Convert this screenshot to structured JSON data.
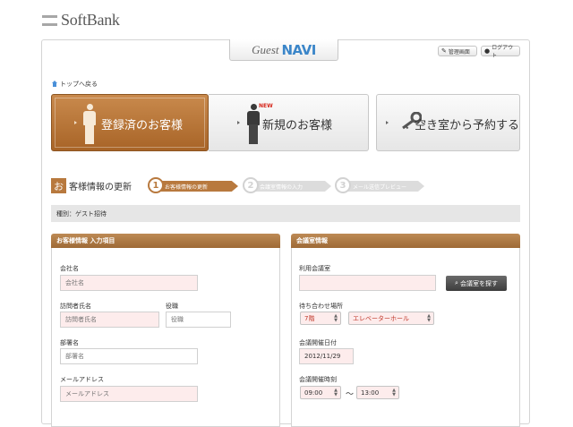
{
  "brand": {
    "name": "SoftBank"
  },
  "app_logo": {
    "guest": "Guest",
    "navi": "NAVI"
  },
  "header_buttons": {
    "admin": "管理画面",
    "logout": "ログアウト"
  },
  "back_link": "トップへ戻る",
  "nav": {
    "registered": "登録済のお客様",
    "new": "新規のお客様",
    "new_badge": "NEW",
    "reserve": "空き室から予約する"
  },
  "section": {
    "icon_char": "お",
    "title": "客様情報の更新"
  },
  "steps": [
    {
      "num": "1",
      "label": "お客様情報の更新"
    },
    {
      "num": "2",
      "label": "会議室情報の入力"
    },
    {
      "num": "3",
      "label": "メール送信プレビュー"
    }
  ],
  "type_bar": "種別：ゲスト招待",
  "guest_panel": {
    "title": "お客様情報 入力項目",
    "company_label": "会社名",
    "company_placeholder": "会社名",
    "visitor_label": "訪問者氏名",
    "visitor_placeholder": "訪問者氏名",
    "position_label": "役職",
    "position_placeholder": "役職",
    "dept_label": "部署名",
    "dept_placeholder": "部署名",
    "email_label": "メールアドレス",
    "email_placeholder": "メールアドレス"
  },
  "room_panel": {
    "title": "会議室情報",
    "room_label": "利用会議室",
    "search_button": "会議室を探す",
    "meeting_place_label": "待ち合わせ場所",
    "floor_value": "7階",
    "place_value": "エレベーターホール",
    "date_label": "会議開催日付",
    "date_value": "2012/11/29",
    "time_label": "会議開催時刻",
    "start_time": "09:00",
    "tilde": "〜",
    "end_time": "13:00"
  },
  "colors": {
    "accent": "#b8793e",
    "navi_blue": "#3b86c9",
    "new_red": "#d6261b"
  },
  "icons": {
    "admin": "wrench-icon",
    "logout": "user-icon",
    "home": "home-icon",
    "search": "magnifier-icon",
    "key": "key-icon"
  }
}
